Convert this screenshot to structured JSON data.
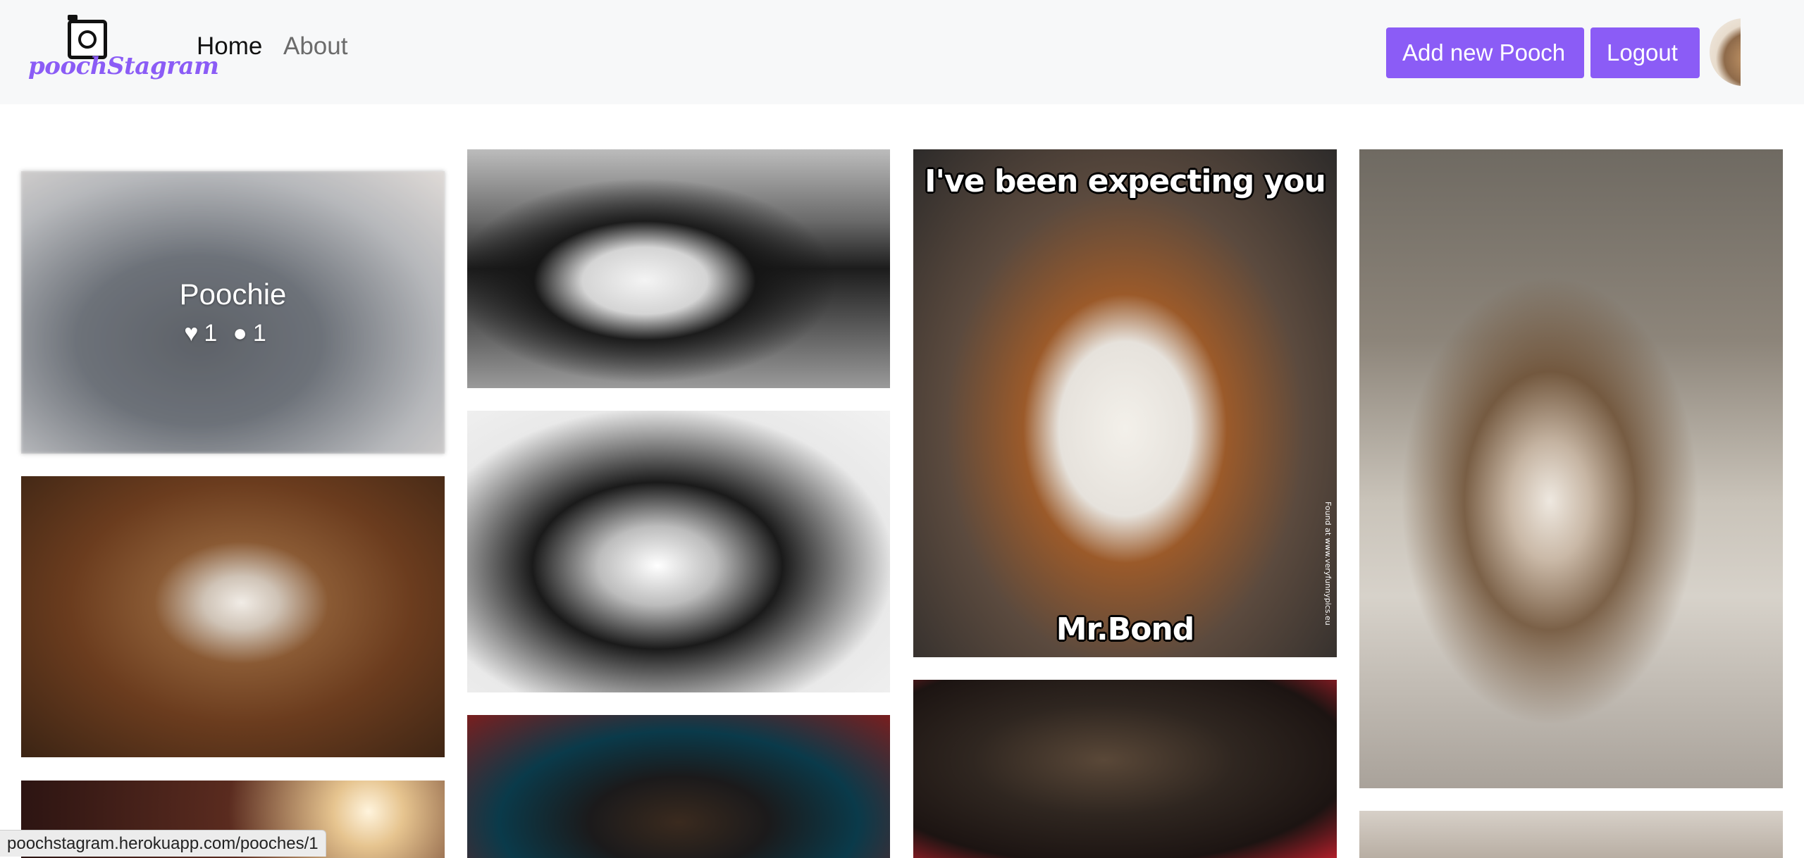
{
  "navbar": {
    "logo_text": "poochStagram",
    "links": [
      {
        "label": "Home"
      },
      {
        "label": "About"
      }
    ],
    "add_button_label": "Add new Pooch",
    "logout_button_label": "Logout"
  },
  "feed": {
    "hovered_post": {
      "name": "Poochie",
      "likes": "1",
      "comments": "1"
    },
    "meme": {
      "top_text": "I've been expecting you",
      "bottom_text": "Mr.Bond",
      "side_text": "Found at www.veryfunnypics.eu"
    }
  },
  "status_bar": {
    "url": "poochstagram.herokuapp.com/pooches/1"
  },
  "colors": {
    "accent": "#8b5cf6",
    "navbar_bg": "#f7f8f9"
  },
  "icons": {
    "heart": "heart-icon",
    "comment": "comment-icon"
  }
}
